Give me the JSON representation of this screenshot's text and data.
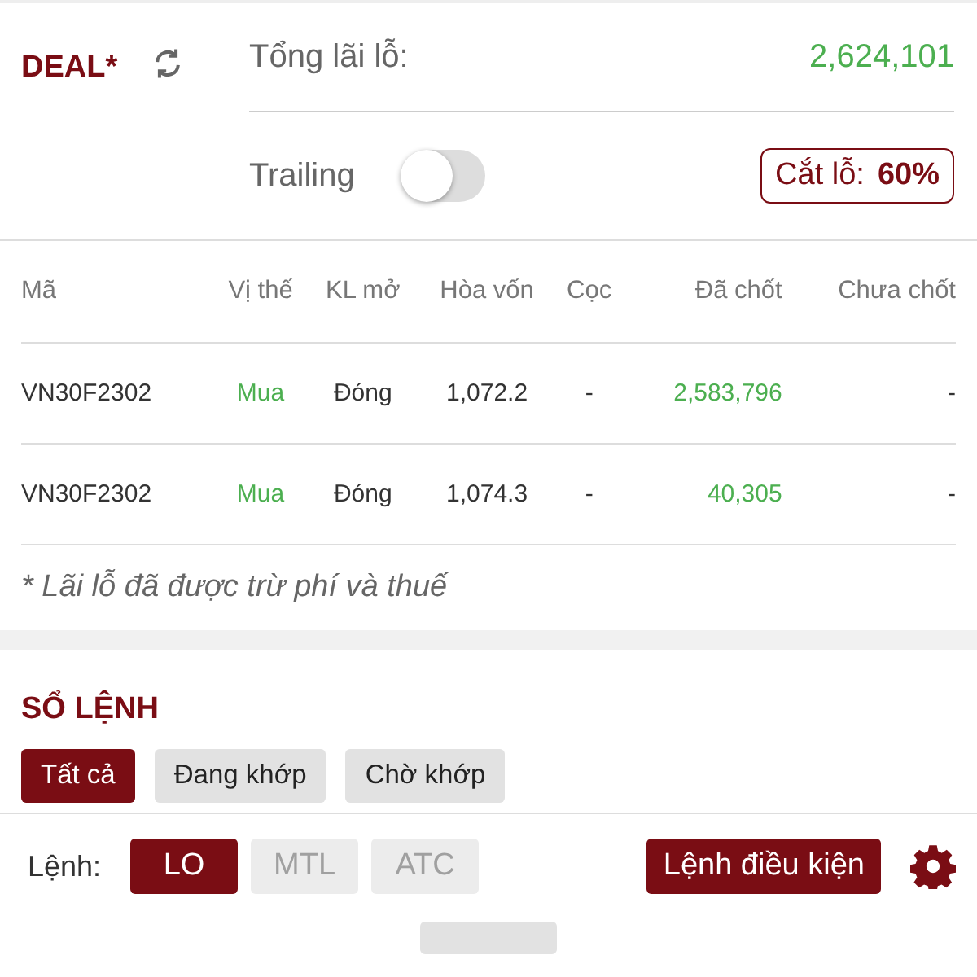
{
  "deal": {
    "title": "DEAL*",
    "total_label": "Tổng lãi lỗ:",
    "total_value": "2,624,101",
    "trailing_label": "Trailing",
    "trailing_on": false,
    "stop_loss_label": "Cắt lỗ:",
    "stop_loss_value": "60%"
  },
  "table": {
    "columns": [
      "Mã",
      "Vị thế",
      "KL mở",
      "Hòa vốn",
      "Cọc",
      "Đã chốt",
      "Chưa chốt"
    ],
    "rows": [
      {
        "cells": [
          "VN30F2302",
          "Mua",
          "Đóng",
          "1,072.2",
          "-",
          "2,583,796",
          "-"
        ]
      },
      {
        "cells": [
          "VN30F2302",
          "Mua",
          "Đóng",
          "1,074.3",
          "-",
          "40,305",
          "-"
        ]
      }
    ]
  },
  "note": "* Lãi lỗ đã được trừ phí và thuế",
  "order_book": {
    "title": "SỔ LỆNH",
    "tabs": [
      {
        "label": "Tất cả",
        "selected": true
      },
      {
        "label": "Đang khớp",
        "selected": false
      },
      {
        "label": "Chờ khớp",
        "selected": false
      }
    ],
    "order_label": "Lệnh:",
    "order_types": [
      {
        "label": "LO",
        "selected": true,
        "disabled": false
      },
      {
        "label": "MTL",
        "selected": false,
        "disabled": true
      },
      {
        "label": "ATC",
        "selected": false,
        "disabled": true
      }
    ],
    "conditional_button": "Lệnh điều kiện"
  }
}
